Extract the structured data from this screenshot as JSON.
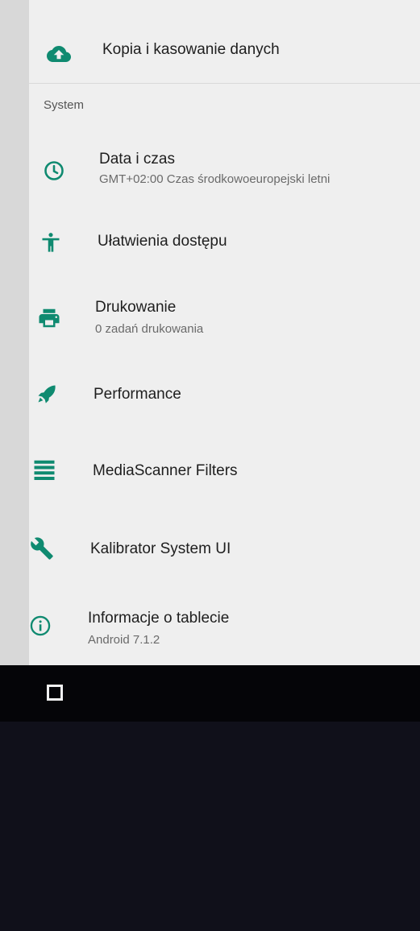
{
  "colors": {
    "accent": "#0f8a70",
    "list_background": "#efefef",
    "nav_background": "#050508"
  },
  "top_item": {
    "label": "Kopia i kasowanie danych",
    "icon": "cloud-upload-icon"
  },
  "section": {
    "header": "System"
  },
  "items": [
    {
      "label": "Data i czas",
      "summary": "GMT+02:00 Czas środkowoeuropejski letni",
      "icon": "clock-icon"
    },
    {
      "label": "Ułatwienia dostępu",
      "icon": "accessibility-icon"
    },
    {
      "label": "Drukowanie",
      "summary": "0 zadań drukowania",
      "icon": "printer-icon"
    },
    {
      "label": "Performance",
      "icon": "rocket-icon"
    },
    {
      "label": "MediaScanner Filters",
      "icon": "list-icon"
    },
    {
      "label": "Kalibrator System UI",
      "icon": "wrench-icon"
    },
    {
      "label": "Informacje o tablecie",
      "summary": "Android 7.1.2",
      "icon": "info-icon"
    }
  ],
  "navbar": {
    "recents_icon": "square-icon"
  }
}
